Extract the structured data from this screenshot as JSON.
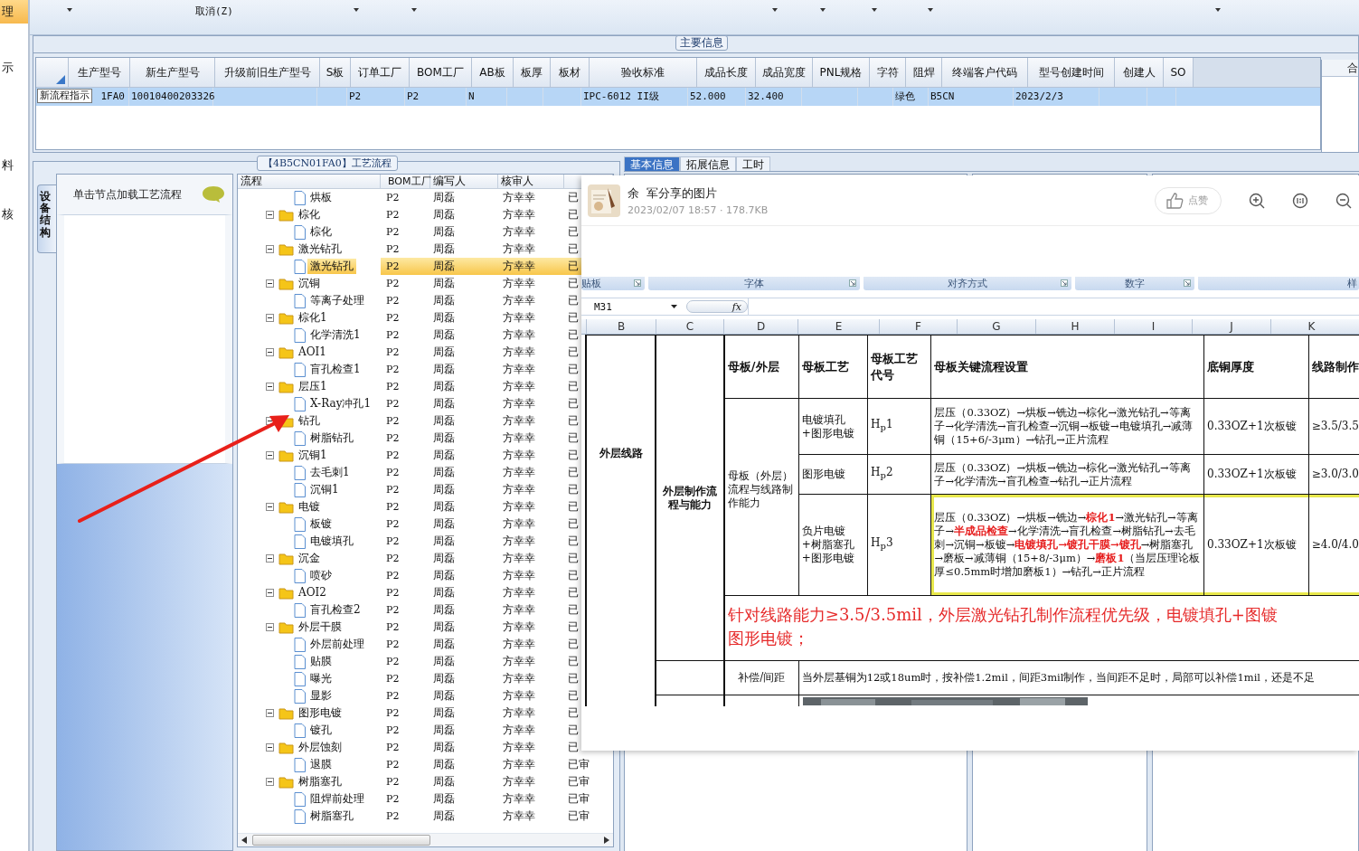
{
  "left_strip": {
    "items": [
      {
        "label": "理",
        "selected": true
      },
      {
        "label": "示",
        "selected": false
      },
      {
        "label": "料",
        "selected": false
      },
      {
        "label": "核",
        "selected": false
      }
    ]
  },
  "toolbar": {
    "label": "取消(Z)"
  },
  "main_info": {
    "title": "主要信息",
    "tooltip": "新流程指示",
    "columns": [
      "生产型号",
      "新生产型号",
      "升级前旧生产型号",
      "S板",
      "订单工厂",
      "BOM工厂",
      "AB板",
      "板厚",
      "板材",
      "验收标准",
      "成品长度",
      "成品宽度",
      "PNL规格",
      "字符",
      "阻焊",
      "终端客户代码",
      "型号创建时间",
      "创建人",
      "SO"
    ],
    "rows": [
      {
        "selected": true,
        "cells": [
          "1FA0",
          "10010400203326",
          "",
          "",
          "P2",
          "P2",
          "N",
          "",
          "",
          "IPC-6012 II级",
          "52.000",
          "32.400",
          "",
          "",
          "绿色",
          "B5CN",
          "2023/2/3",
          "",
          ""
        ]
      }
    ]
  },
  "right_panel": {
    "header": "合"
  },
  "process": {
    "title": "【4B5CN01FA0】工艺流程",
    "side_tab": "设备结构",
    "hint": "单击节点加载工艺流程",
    "columns": [
      "流程",
      "BOM工厂",
      "编写人",
      "核审人"
    ],
    "tree": [
      {
        "label": "烘板",
        "kind": "leaf",
        "selected": false,
        "cells": [
          "P2",
          "周磊",
          "方幸幸",
          "已"
        ]
      },
      {
        "label": "棕化",
        "kind": "folder",
        "expanded": true,
        "selected": false,
        "cells": [
          "P2",
          "周磊",
          "方幸幸",
          "已"
        ],
        "children": [
          {
            "label": "棕化",
            "kind": "leaf",
            "selected": false,
            "cells": [
              "P2",
              "周磊",
              "方幸幸",
              "已"
            ]
          }
        ]
      },
      {
        "label": "激光钻孔",
        "kind": "folder",
        "expanded": true,
        "selected": false,
        "cells": [
          "P2",
          "周磊",
          "方幸幸",
          "已"
        ],
        "children": [
          {
            "label": "激光钻孔",
            "kind": "leaf",
            "selected": true,
            "cells": [
              "P2",
              "周磊",
              "方幸幸",
              "已"
            ]
          }
        ]
      },
      {
        "label": "沉铜",
        "kind": "folder",
        "expanded": true,
        "selected": false,
        "cells": [
          "P2",
          "周磊",
          "方幸幸",
          "已"
        ],
        "children": [
          {
            "label": "等离子处理",
            "kind": "leaf",
            "selected": false,
            "cells": [
              "P2",
              "周磊",
              "方幸幸",
              "已"
            ]
          }
        ]
      },
      {
        "label": "棕化1",
        "kind": "folder",
        "expanded": true,
        "selected": false,
        "cells": [
          "P2",
          "周磊",
          "方幸幸",
          "已"
        ],
        "children": [
          {
            "label": "化学清洗1",
            "kind": "leaf",
            "selected": false,
            "cells": [
              "P2",
              "周磊",
              "方幸幸",
              "已"
            ]
          }
        ]
      },
      {
        "label": "AOI1",
        "kind": "folder",
        "expanded": true,
        "selected": false,
        "cells": [
          "P2",
          "周磊",
          "方幸幸",
          "已"
        ],
        "children": [
          {
            "label": "盲孔检查1",
            "kind": "leaf",
            "selected": false,
            "cells": [
              "P2",
              "周磊",
              "方幸幸",
              "已"
            ]
          }
        ]
      },
      {
        "label": "层压1",
        "kind": "folder",
        "expanded": true,
        "selected": false,
        "cells": [
          "P2",
          "周磊",
          "方幸幸",
          "已"
        ],
        "children": [
          {
            "label": "X-Ray冲孔1",
            "kind": "leaf",
            "selected": false,
            "cells": [
              "P2",
              "周磊",
              "方幸幸",
              "已"
            ]
          }
        ]
      },
      {
        "label": "钻孔",
        "kind": "folder",
        "expanded": true,
        "selected": false,
        "cells": [
          "P2",
          "周磊",
          "方幸幸",
          "已"
        ],
        "children": [
          {
            "label": "树脂钻孔",
            "kind": "leaf",
            "selected": false,
            "cells": [
              "P2",
              "周磊",
              "方幸幸",
              "已"
            ]
          }
        ]
      },
      {
        "label": "沉铜1",
        "kind": "folder",
        "expanded": true,
        "selected": false,
        "cells": [
          "P2",
          "周磊",
          "方幸幸",
          "已"
        ],
        "children": [
          {
            "label": "去毛刺1",
            "kind": "leaf",
            "selected": false,
            "cells": [
              "P2",
              "周磊",
              "方幸幸",
              "已"
            ]
          },
          {
            "label": "沉铜1",
            "kind": "leaf",
            "selected": false,
            "cells": [
              "P2",
              "周磊",
              "方幸幸",
              "已"
            ]
          }
        ]
      },
      {
        "label": "电镀",
        "kind": "folder",
        "expanded": true,
        "selected": false,
        "cells": [
          "P2",
          "周磊",
          "方幸幸",
          "已"
        ],
        "children": [
          {
            "label": "板镀",
            "kind": "leaf",
            "selected": false,
            "cells": [
              "P2",
              "周磊",
              "方幸幸",
              "已"
            ]
          },
          {
            "label": "电镀填孔",
            "kind": "leaf",
            "selected": false,
            "cells": [
              "P2",
              "周磊",
              "方幸幸",
              "已"
            ]
          }
        ]
      },
      {
        "label": "沉金",
        "kind": "folder",
        "expanded": true,
        "selected": false,
        "cells": [
          "P2",
          "周磊",
          "方幸幸",
          "已"
        ],
        "children": [
          {
            "label": "喷砂",
            "kind": "leaf",
            "selected": false,
            "cells": [
              "P2",
              "周磊",
              "方幸幸",
              "已"
            ]
          }
        ]
      },
      {
        "label": "AOI2",
        "kind": "folder",
        "expanded": true,
        "selected": false,
        "cells": [
          "P2",
          "周磊",
          "方幸幸",
          "已"
        ],
        "children": [
          {
            "label": "盲孔检查2",
            "kind": "leaf",
            "selected": false,
            "cells": [
              "P2",
              "周磊",
              "方幸幸",
              "已"
            ]
          }
        ]
      },
      {
        "label": "外层干膜",
        "kind": "folder",
        "expanded": true,
        "selected": false,
        "cells": [
          "P2",
          "周磊",
          "方幸幸",
          "已"
        ],
        "children": [
          {
            "label": "外层前处理",
            "kind": "leaf",
            "selected": false,
            "cells": [
              "P2",
              "周磊",
              "方幸幸",
              "已"
            ]
          },
          {
            "label": "贴膜",
            "kind": "leaf",
            "selected": false,
            "cells": [
              "P2",
              "周磊",
              "方幸幸",
              "已"
            ]
          },
          {
            "label": "曝光",
            "kind": "leaf",
            "selected": false,
            "cells": [
              "P2",
              "周磊",
              "方幸幸",
              "已"
            ]
          },
          {
            "label": "显影",
            "kind": "leaf",
            "selected": false,
            "cells": [
              "P2",
              "周磊",
              "方幸幸",
              "已"
            ]
          }
        ]
      },
      {
        "label": "图形电镀",
        "kind": "folder",
        "expanded": true,
        "selected": false,
        "cells": [
          "P2",
          "周磊",
          "方幸幸",
          "已"
        ],
        "children": [
          {
            "label": "镀孔",
            "kind": "leaf",
            "selected": false,
            "cells": [
              "P2",
              "周磊",
              "方幸幸",
              "已"
            ]
          }
        ]
      },
      {
        "label": "外层蚀刻",
        "kind": "folder",
        "expanded": true,
        "selected": false,
        "cells": [
          "P2",
          "周磊",
          "方幸幸",
          "已"
        ],
        "children": [
          {
            "label": "退膜",
            "kind": "leaf",
            "selected": false,
            "cells": [
              "P2",
              "周磊",
              "方幸幸",
              "已审"
            ]
          }
        ]
      },
      {
        "label": "树脂塞孔",
        "kind": "folder",
        "expanded": true,
        "selected": false,
        "cells": [
          "P2",
          "周磊",
          "方幸幸",
          "已审"
        ],
        "children": [
          {
            "label": "阻焊前处理",
            "kind": "leaf",
            "selected": false,
            "cells": [
              "P2",
              "周磊",
              "方幸幸",
              "已审"
            ]
          },
          {
            "label": "树脂塞孔",
            "kind": "leaf",
            "selected": false,
            "cells": [
              "P2",
              "周磊",
              "方幸幸",
              "已审"
            ]
          }
        ]
      }
    ]
  },
  "detail_tabs": [
    {
      "label": "基本信息",
      "selected": true
    },
    {
      "label": "拓展信息",
      "selected": false
    },
    {
      "label": "工时",
      "selected": false
    }
  ],
  "viewer": {
    "sender": "余  军分享的图片",
    "meta": "2023/02/07 18:57 · 178.7KB",
    "like": "点赞",
    "image": {
      "ribbon_groups": [
        "贴板",
        "字体",
        "对齐方式",
        "数字",
        "样"
      ],
      "name_box": "M31",
      "fx": "fx",
      "columns": [
        "B",
        "C",
        "D",
        "E",
        "F",
        "G",
        "H",
        "I",
        "J",
        "K"
      ],
      "section": "外层线路",
      "subsection": "外层制作流程与能力",
      "headers": [
        "母板/外层",
        "母板工艺",
        "母板工艺代号",
        "母板关键流程设置",
        "底铜厚度",
        "线路制作"
      ],
      "group_label": "母板（外层）流程与线路制作能力",
      "rows": [
        {
          "process": "电镀填孔+图形电镀",
          "code": "H$_{p}$1",
          "flow": "层压（0.33OZ）→烘板→铣边→棕化→激光钻孔→等离子→化学清洗→盲孔检查→沉铜→板镀→电镀填孔→减薄铜（15+6/-3μm）→钻孔→正片流程",
          "copper": "0.33OZ+1次板镀",
          "line": "≥3.5/3.5",
          "highlighted": false
        },
        {
          "process": "图形电镀",
          "code": "H$_{p}$2",
          "flow": "层压（0.33OZ）→烘板→铣边→棕化→激光钻孔→等离子→化学清洗→盲孔检查→钻孔→正片流程",
          "copper": "0.33OZ+1次板镀",
          "line": "≥3.0/3.0",
          "highlighted": false
        },
        {
          "process": "负片电镀+树脂塞孔+图形电镀",
          "code": "H$_{p}$3",
          "flow": "层压（0.33OZ）→烘板→铣边→**棕化1**→激光钻孔→等离子→**半成品检查**→化学清洗→盲孔检查→树脂钻孔→去毛刺→沉铜→板镀→**电镀填孔→镀孔干膜→镀孔**→树脂塞孔→磨板→减薄铜（15+8/-3μm）→**磨板1**（当层压理论板厚≤0.5mm时增加磨板1）→钻孔→正片流程",
          "copper": "0.33OZ+1次板镀",
          "line": "≥4.0/4.0",
          "highlighted": true
        }
      ],
      "note": [
        "针对线路能力≥3.5/3.5mil，外层激光钻孔制作流程优先级，电镀填孔+图镀",
        "图形电镀；"
      ],
      "comp_label": "补偿/间距",
      "comp_text": "当外层基铜为12或18um时，按补偿1.2mil，间距3mil制作，当间距不足时，局部可以补偿1mil，还是不足"
    }
  }
}
